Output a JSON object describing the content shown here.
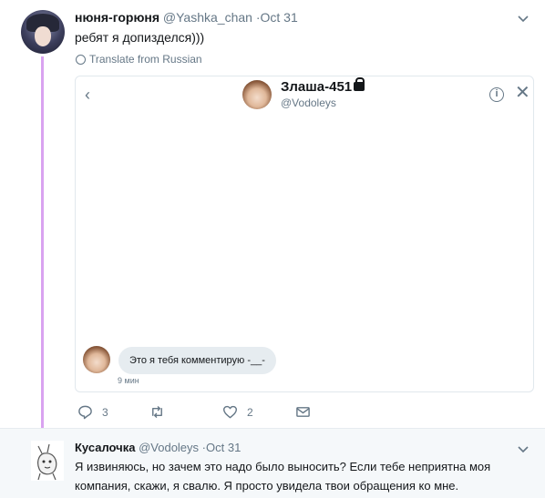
{
  "tweet1": {
    "author_name": "нюня-горюня",
    "author_handle": "@Yashka_chan",
    "separator": "·",
    "time": "Oct 31",
    "text": "ребят я допизделся)))",
    "translate_label": "Translate from Russian",
    "dm_card": {
      "name": "Злаша-451",
      "handle": "@Vodoleys",
      "info_glyph": "i",
      "close_glyph": "✕",
      "back_glyph": "‹",
      "message_text": "Это я тебя комментирую -__-",
      "message_time": "9 мин"
    },
    "actions": {
      "reply_count": "3",
      "retweet_count": "",
      "like_count": "2"
    }
  },
  "tweet2": {
    "author_name": "Кусалочка",
    "author_handle": "@Vodoleys",
    "separator": "·",
    "time": "Oct 31",
    "text": "Я извиняюсь, но зачем это надо было выносить? Если тебе неприятна моя компания, скажи, я свалю. Я просто увидела твои обращения ко мне."
  },
  "colors": {
    "thread_line": "#d9a3f0",
    "text_secondary": "#657786",
    "bubble_bg": "#e6ecf0",
    "reply_bg": "#f5f8fa"
  }
}
